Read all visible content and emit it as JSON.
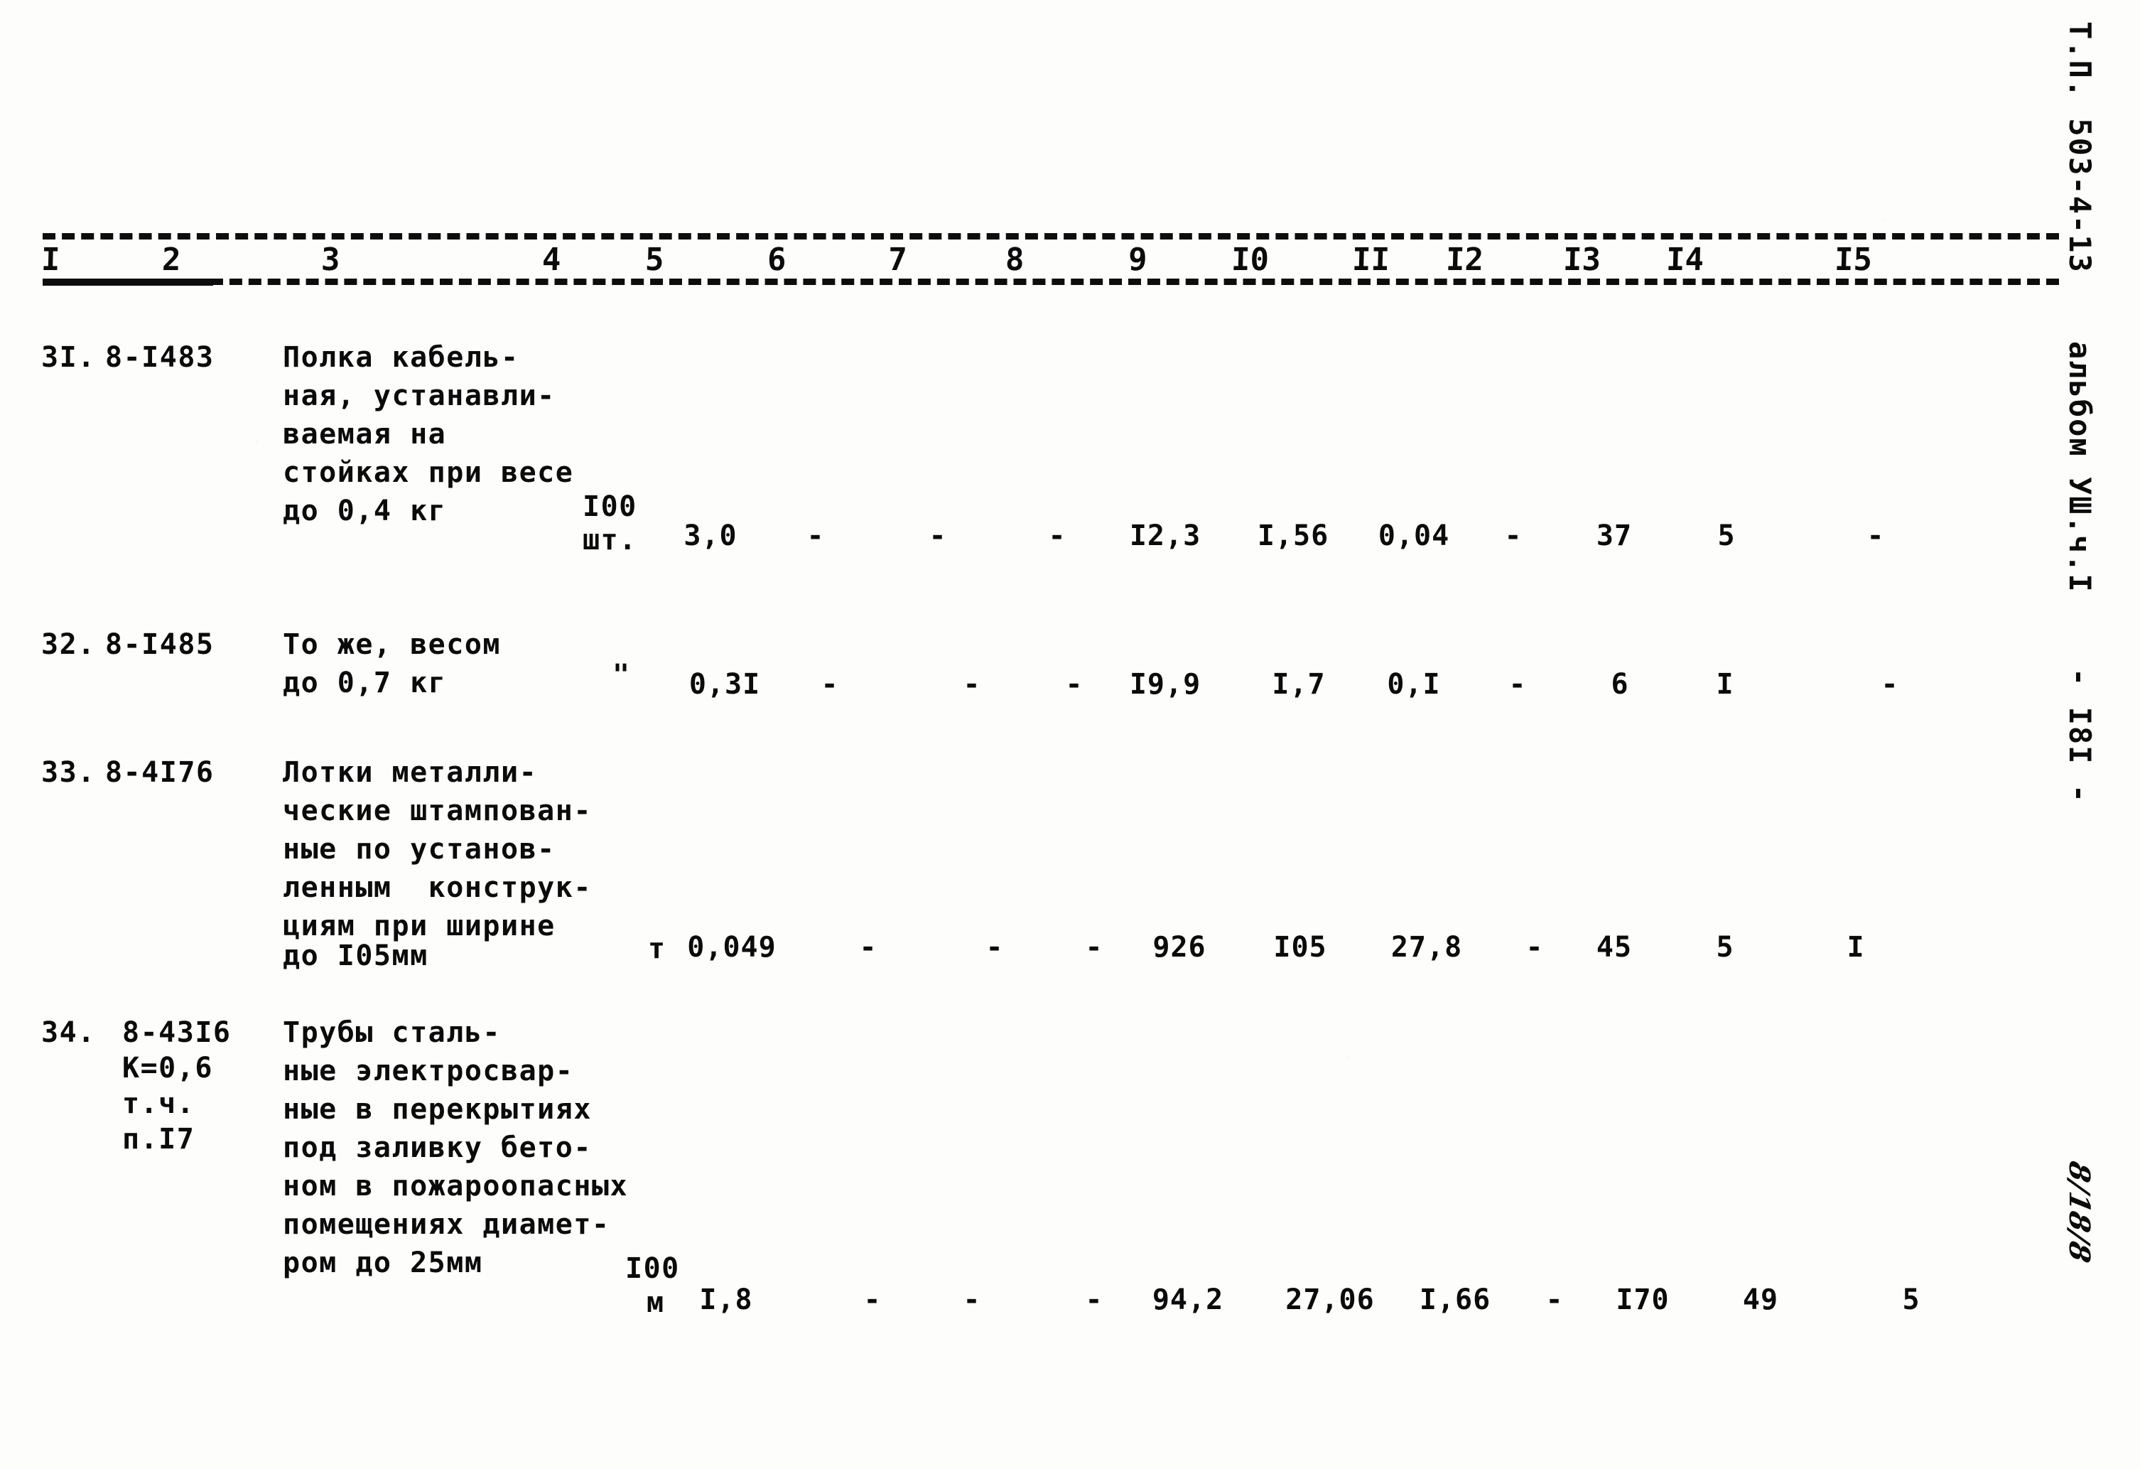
{
  "document": {
    "margin_right_top": "Т.П. 503-4-13",
    "margin_right_album": "альбом УШ.ч.I",
    "page_number": "- I8I -",
    "handwritten_mark": "8/18/8"
  },
  "table": {
    "column_headers": [
      "I",
      "2",
      "3",
      "4",
      "5",
      "6",
      "7",
      "8",
      "9",
      "I0",
      "II",
      "I2",
      "I3",
      "I4",
      "I5"
    ],
    "rows": [
      {
        "no": "3I.",
        "code": "8-I483",
        "description": [
          "Полка кабель-",
          "ная, устанавли-",
          "ваемая на",
          "стойках при весе",
          "до 0,4 кг"
        ],
        "unit_lines": [
          "I00",
          "шт."
        ],
        "values": [
          "3,0",
          "-",
          "-",
          "-",
          "I2,3",
          "I,56",
          "0,04",
          "-",
          "37",
          "5",
          "-"
        ]
      },
      {
        "no": "32.",
        "code": "8-I485",
        "description": [
          "То же, весом",
          "до 0,7 кг"
        ],
        "unit_lines": [
          "\""
        ],
        "values": [
          "0,3I",
          "-",
          "-",
          "-",
          "I9,9",
          "I,7",
          "0,I",
          "-",
          "6",
          "I",
          "-"
        ]
      },
      {
        "no": "33.",
        "code": "8-4I76",
        "description": [
          "Лотки металли-",
          "ческие штампован-",
          "ные по установ-",
          "ленным  конструк-",
          "циям при ширине",
          "до I05мм"
        ],
        "unit_lines": [
          "т"
        ],
        "values": [
          "0,049",
          "-",
          "-",
          "-",
          "926",
          "I05",
          "27,8",
          "-",
          "45",
          "5",
          "I"
        ]
      },
      {
        "no": "34.",
        "code": "8-43I6",
        "code_extra": [
          "К=0,6",
          "т.ч.",
          "п.I7"
        ],
        "description": [
          "Трубы сталь-",
          "ные электросвар-",
          "ные в перекрытиях",
          "под заливку бето-",
          "ном в пожароопасных",
          "помещениях диамет-",
          "ром до 25мм"
        ],
        "unit_lines": [
          "I00",
          "м"
        ],
        "values": [
          "I,8",
          "-",
          "-",
          "-",
          "94,2",
          "27,06",
          "I,66",
          "-",
          "I70",
          "49",
          "5"
        ]
      }
    ]
  }
}
